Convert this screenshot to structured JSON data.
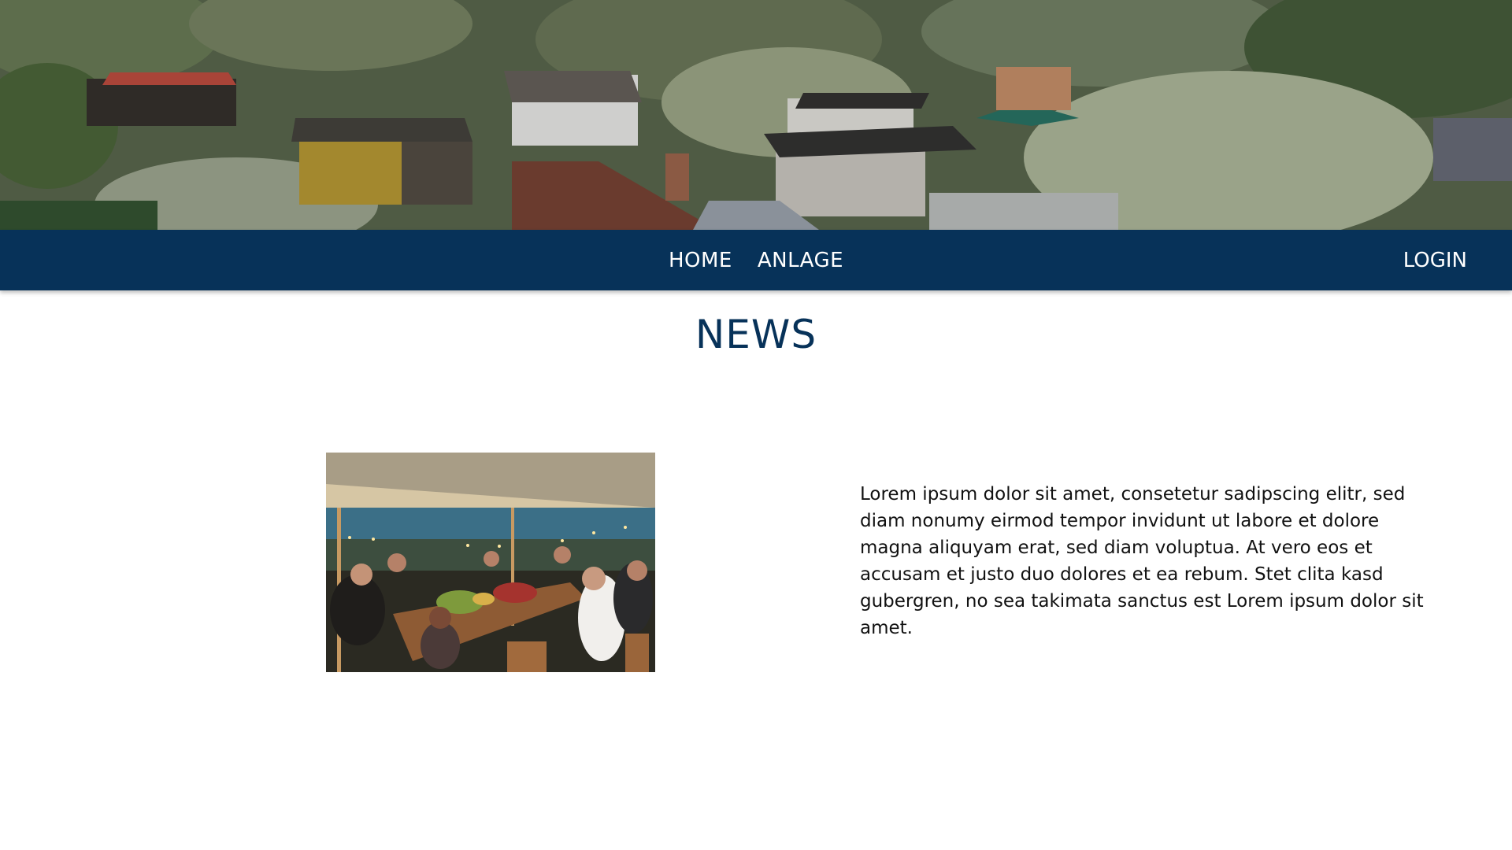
{
  "hero": {
    "image_icon": "allotment-garden-photo"
  },
  "nav": {
    "items": [
      {
        "label": "HOME"
      },
      {
        "label": "ANLAGE"
      }
    ],
    "login_label": "LOGIN"
  },
  "main": {
    "title": "NEWS",
    "article": {
      "image_icon": "dinner-party-photo",
      "text": "Lorem ipsum dolor sit amet, consetetur sadipscing elitr, sed diam nonumy eirmod tempor invidunt ut labore et dolore magna aliquyam erat, sed diam voluptua. At vero eos et accusam et justo duo dolores et ea rebum. Stet clita kasd gubergren, no sea takimata sanctus est Lorem ipsum dolor sit amet."
    }
  },
  "colors": {
    "nav_background": "#073259",
    "title_color": "#073259",
    "text_color": "#111111"
  }
}
